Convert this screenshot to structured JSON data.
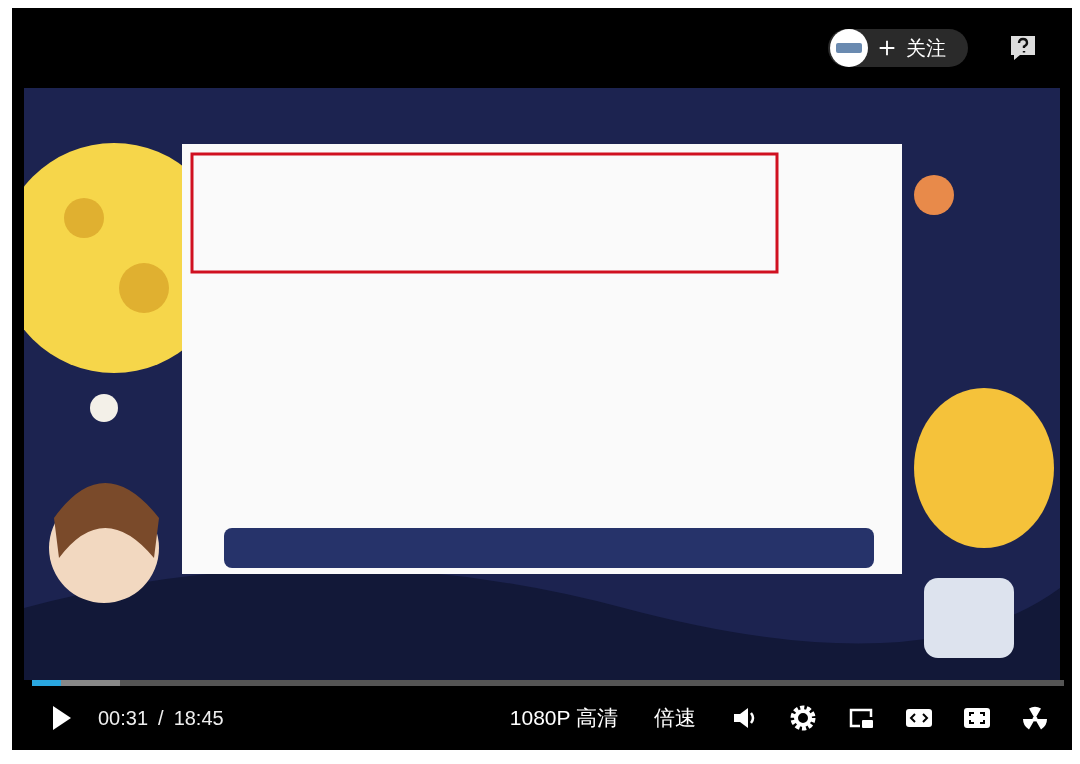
{
  "header": {
    "follow_label": "关注"
  },
  "progress": {
    "level": 0.028
  },
  "controls": {
    "current_time": "00:31",
    "separator": "/",
    "duration": "18:45",
    "quality": "1080P 高清",
    "speed": "倍速"
  }
}
